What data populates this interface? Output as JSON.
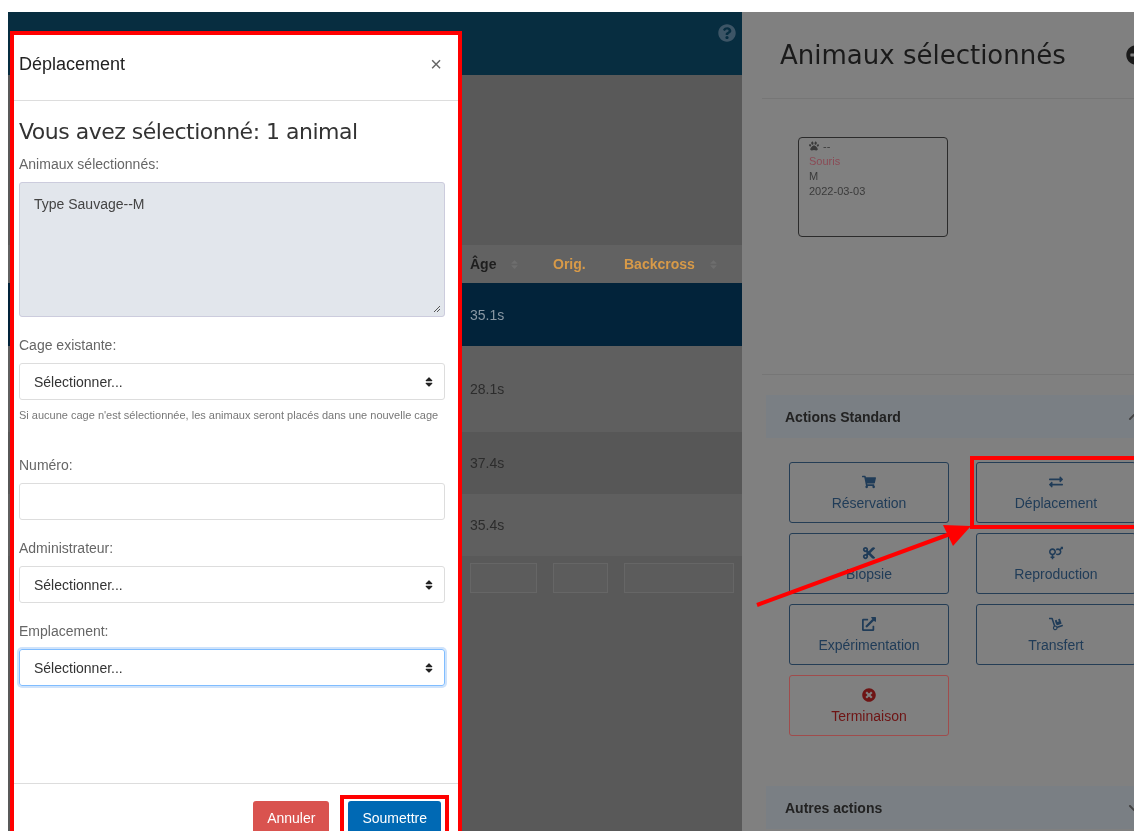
{
  "background": {
    "table": {
      "columns": [
        {
          "label": "Âge",
          "kind": "plain",
          "sortable": true
        },
        {
          "label": "Orig.",
          "kind": "link",
          "sortable": false
        },
        {
          "label": "Backcross",
          "kind": "link",
          "sortable": true
        }
      ],
      "rows": [
        {
          "cells": [
            "35.1s"
          ],
          "selected": true
        },
        {
          "cells": [
            "28.1s"
          ],
          "selected": false
        },
        {
          "cells": [
            "37.4s"
          ],
          "selected": false
        },
        {
          "cells": [
            "35.4s"
          ],
          "selected": false
        }
      ]
    }
  },
  "modal": {
    "title": "Déplacement",
    "close": "×",
    "highlighted": true,
    "heading": "Vous avez sélectionné: 1 animal",
    "fields": [
      {
        "kind": "textarea",
        "label": "Animaux sélectionnés:",
        "value": "Type Sauvage--M"
      },
      {
        "kind": "select",
        "label": "Cage existante:",
        "value": "Sélectionner...",
        "help": "Si aucune cage n'est sélectionnée, les animaux seront placés dans une nouvelle cage",
        "focused": false
      },
      {
        "kind": "text",
        "label": "Numéro:",
        "focused": false
      },
      {
        "kind": "select",
        "label": "Administrateur:",
        "value": "Sélectionner...",
        "focused": false
      },
      {
        "kind": "select",
        "label": "Emplacement:",
        "value": "Sélectionner...",
        "focused": true
      }
    ],
    "buttons": [
      {
        "label": "Annuler",
        "kind": "danger",
        "highlighted": false
      },
      {
        "label": "Soumettre",
        "kind": "primary",
        "highlighted": true
      }
    ]
  },
  "panel": {
    "title": "Animaux sélectionnés",
    "card": {
      "id": "--",
      "species": "Souris",
      "sex": "M",
      "date": "2022-03-03"
    },
    "sections": [
      {
        "title": "Actions Standard",
        "expanded": true,
        "actions": [
          {
            "label": "Réservation",
            "kind": "normal",
            "highlighted": false
          },
          {
            "label": "Déplacement",
            "kind": "normal",
            "highlighted": true
          },
          {
            "label": "Biopsie",
            "kind": "normal",
            "highlighted": false
          },
          {
            "label": "Reproduction",
            "kind": "normal",
            "highlighted": false
          },
          {
            "label": "Expérimentation",
            "kind": "normal",
            "highlighted": false
          },
          {
            "label": "Transfert",
            "kind": "normal",
            "highlighted": false
          },
          {
            "label": "Terminaison",
            "kind": "danger",
            "highlighted": false
          }
        ]
      },
      {
        "title": "Autres actions",
        "expanded": false
      }
    ]
  }
}
